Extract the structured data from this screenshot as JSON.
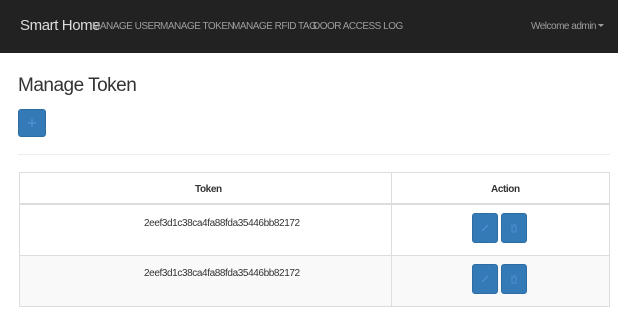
{
  "navbar": {
    "brand": "Smart Home",
    "links": [
      "MANAGE USER",
      "MANAGE TOKEN",
      "MANAGE RFID TAG",
      "DOOR ACCESS LOG"
    ],
    "welcome": "Welcome admin"
  },
  "page": {
    "title": "Manage Token",
    "add_button_icon": "plus-icon"
  },
  "table": {
    "headers": [
      "Token",
      "Action"
    ],
    "rows": [
      {
        "token": "2eef3d1c38ca4fa88fda35446bb82172",
        "edit_icon": "pencil-icon",
        "delete_icon": "trash-icon"
      },
      {
        "token": "2eef3d1c38ca4fa88fda35446bb82172",
        "edit_icon": "pencil-icon",
        "delete_icon": "trash-icon"
      }
    ]
  },
  "colors": {
    "navbar_bg": "#222222",
    "primary": "#337ab7",
    "row_stripe": "#f9f9f9",
    "border": "#dddddd"
  }
}
